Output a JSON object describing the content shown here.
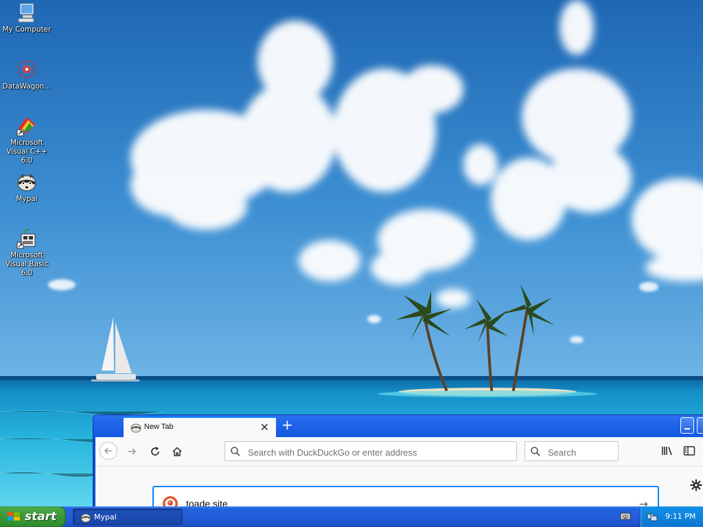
{
  "desktop": {
    "icons": [
      {
        "label": "My Computer",
        "icon": "computer-icon"
      },
      {
        "label": "DataWagon...",
        "icon": "datawagon-icon"
      },
      {
        "label": "Microsoft Visual C++ 6.0",
        "icon": "visual-cpp-icon"
      },
      {
        "label": "Mypal",
        "icon": "mypal-icon"
      },
      {
        "label": "Microsoft Visual Basic 6.0",
        "icon": "visual-basic-icon"
      }
    ]
  },
  "browser": {
    "tab": {
      "title": "New Tab",
      "close": "✕"
    },
    "new_tab": "+",
    "urlbar": {
      "placeholder": "Search with DuckDuckGo or enter address",
      "value": ""
    },
    "searchbar": {
      "placeholder": "Search",
      "value": ""
    },
    "content": {
      "search_query": "toade site",
      "submit": "→"
    }
  },
  "taskbar": {
    "start_label": "start",
    "tasks": [
      {
        "label": "Mypal"
      }
    ],
    "clock": "9:11 PM"
  },
  "colors": {
    "taskbar_blue": "#245edb",
    "start_green": "#3c9a3a",
    "tray_blue": "#0f85df",
    "focus_blue": "#0a84ff"
  }
}
